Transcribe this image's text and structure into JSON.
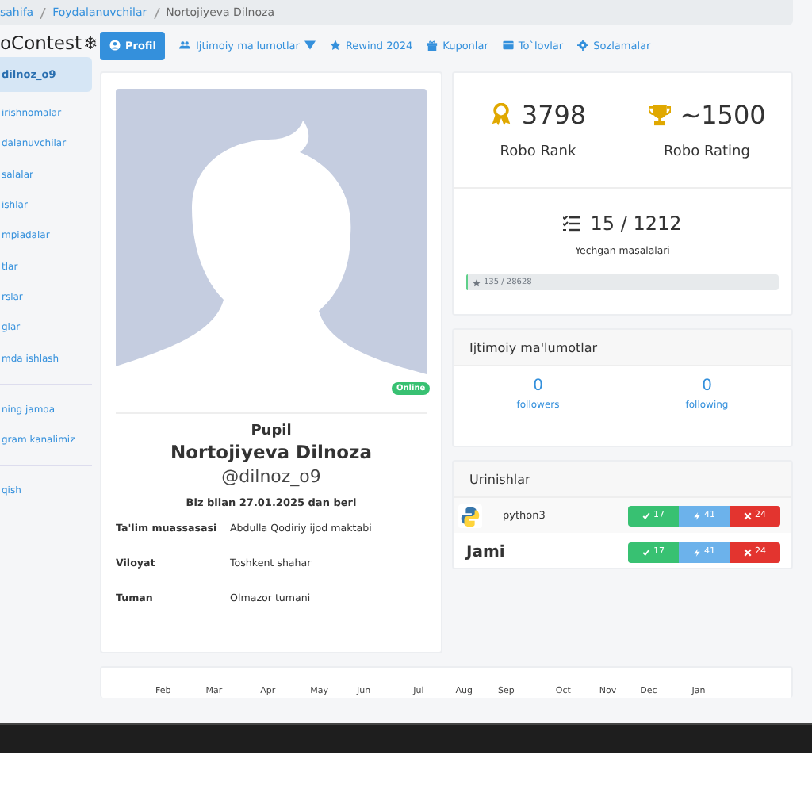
{
  "breadcrumb": [
    {
      "label": "sahifa",
      "kind": "link"
    },
    {
      "label": "Foydalanuvchilar",
      "kind": "link"
    },
    {
      "label": "Nortojiyeva Dilnoza",
      "kind": "current"
    }
  ],
  "brand": {
    "text": "oContest",
    "icon": "❄"
  },
  "sidebar": {
    "items": [
      {
        "label": "dilnoz_o9",
        "selected": true,
        "kind": "item"
      },
      {
        "label": "irishnomalar",
        "selected": false,
        "kind": "item"
      },
      {
        "label": "dalanuvchilar",
        "selected": false,
        "kind": "item"
      },
      {
        "label": "salalar",
        "selected": false,
        "kind": "item"
      },
      {
        "label": "ishlar",
        "selected": false,
        "kind": "item"
      },
      {
        "label": "mpiadalar",
        "selected": false,
        "kind": "item"
      },
      {
        "label": "tlar",
        "selected": false,
        "kind": "item"
      },
      {
        "label": "rslar",
        "selected": false,
        "kind": "item"
      },
      {
        "label": "glar",
        "selected": false,
        "kind": "item"
      },
      {
        "label": "mda ishlash",
        "selected": false,
        "kind": "item"
      },
      {
        "kind": "divider"
      },
      {
        "label": "ning jamoa",
        "selected": false,
        "kind": "item"
      },
      {
        "label": "gram kanalimiz",
        "selected": false,
        "kind": "item"
      },
      {
        "kind": "divider"
      },
      {
        "label": "qish",
        "selected": false,
        "kind": "item"
      }
    ]
  },
  "tabs": [
    {
      "label": "Profil",
      "selected": true,
      "dropdown": false
    },
    {
      "label": "Ijtimoiy ma'lumotlar",
      "selected": false,
      "dropdown": true
    },
    {
      "label": "Rewind 2024",
      "selected": false,
      "dropdown": false
    },
    {
      "label": "Kuponlar",
      "selected": false,
      "dropdown": false
    },
    {
      "label": "To`lovlar",
      "selected": false,
      "dropdown": false
    },
    {
      "label": "Sozlamalar",
      "selected": false,
      "dropdown": false
    }
  ],
  "profile": {
    "online_badge": "Online",
    "role": "Pupil",
    "name": "Nortojiyeva Dilnoza",
    "username": "@dilnoz_o9",
    "since": "Biz bilan 27.01.2025 dan beri",
    "details": [
      {
        "label": "Ta'lim muassasasi",
        "value": "Abdulla Qodiriy ijod maktabi"
      },
      {
        "label": "Viloyat",
        "value": "Toshkent shahar"
      },
      {
        "label": "Tuman",
        "value": "Olmazor tumani"
      }
    ]
  },
  "stats": {
    "rank": {
      "value": "3798",
      "label": "Robo Rank"
    },
    "rating": {
      "value": "~1500",
      "label": "Robo Rating"
    },
    "solved": {
      "value": "15 / 1212",
      "label": "Yechgan masalalari"
    },
    "progress": {
      "text": "135 / 28628",
      "level": 0.005
    }
  },
  "social": {
    "title": "Ijtimoiy ma'lumotlar",
    "items": [
      {
        "count": "0",
        "label": "followers"
      },
      {
        "count": "0",
        "label": "following"
      }
    ]
  },
  "attempts": {
    "title": "Urinishlar",
    "rows": [
      {
        "kind": "language",
        "label": "python3",
        "accepted": "17",
        "partial": "41",
        "wrong": "24"
      },
      {
        "kind": "total",
        "label": "Jami",
        "accepted": "17",
        "partial": "41",
        "wrong": "24"
      }
    ]
  },
  "calendar": {
    "months": [
      "Feb",
      "Mar",
      "Apr",
      "May",
      "Jun",
      "Jul",
      "Aug",
      "Sep",
      "Oct",
      "Nov",
      "Dec",
      "Jan"
    ]
  }
}
